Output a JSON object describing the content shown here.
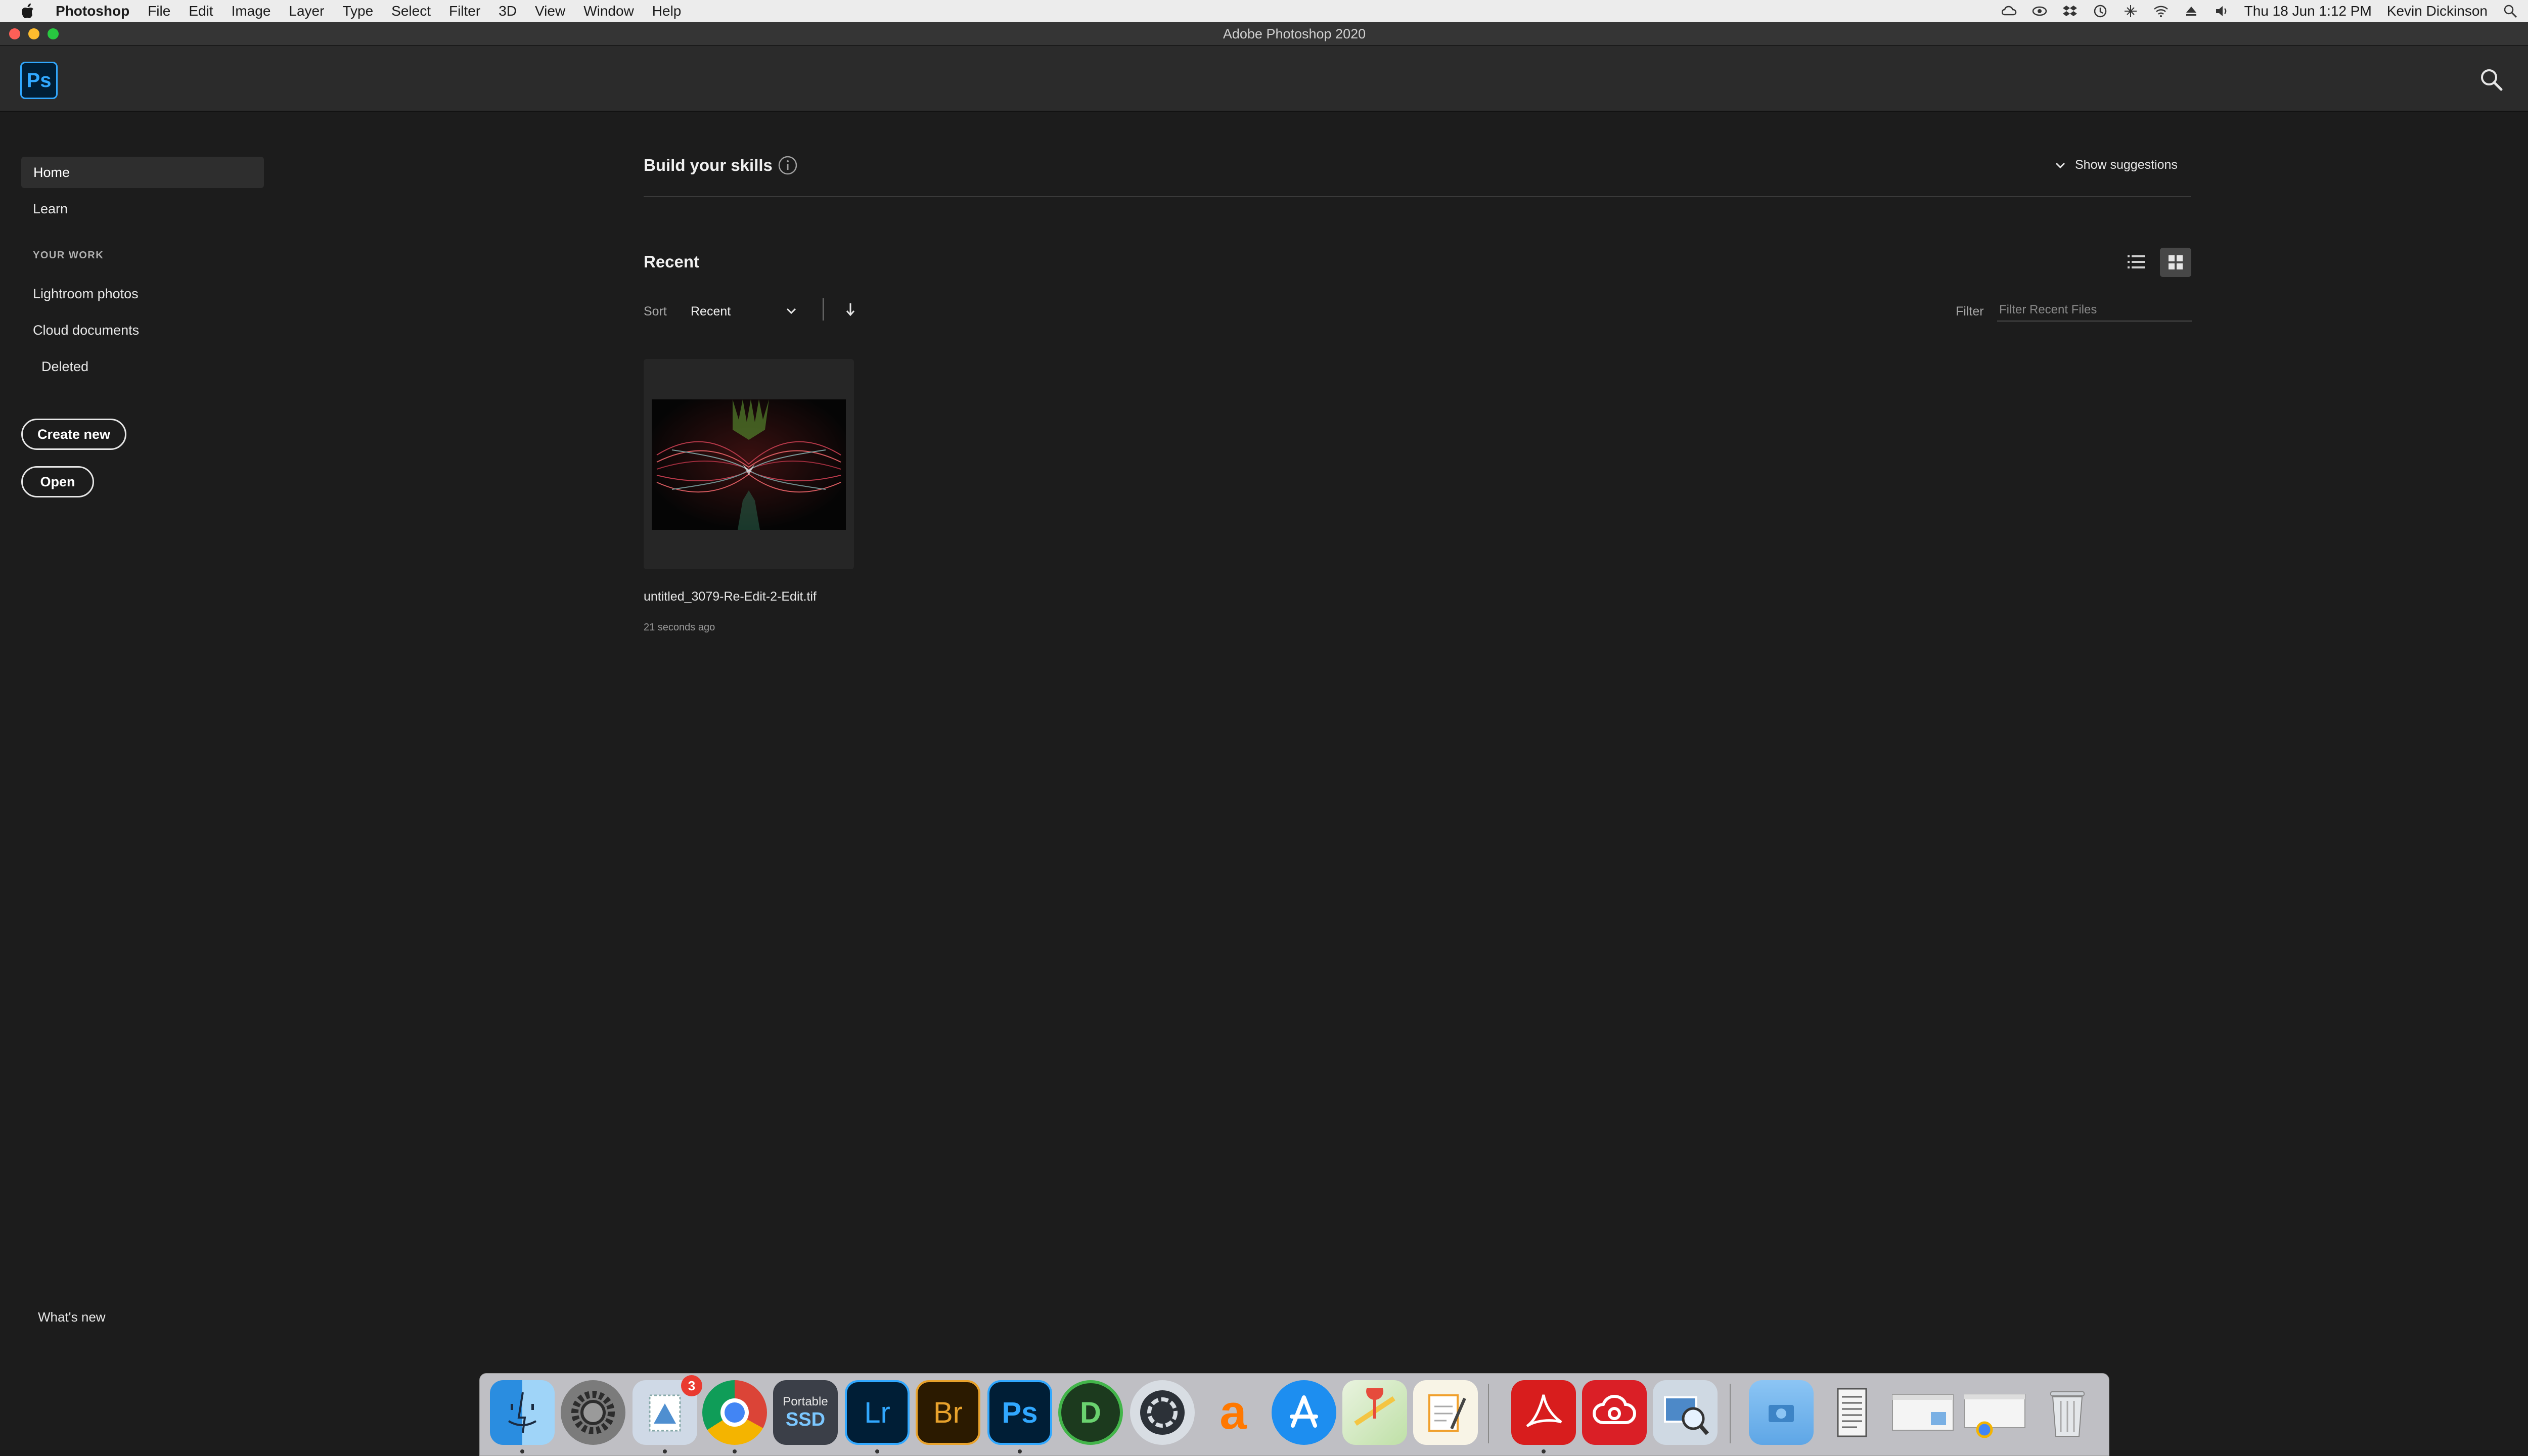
{
  "menubar": {
    "app_name": "Photoshop",
    "menus": [
      "File",
      "Edit",
      "Image",
      "Layer",
      "Type",
      "Select",
      "Filter",
      "3D",
      "View",
      "Window",
      "Help"
    ],
    "clock": "Thu 18 Jun  1:12 PM",
    "user": "Kevin Dickinson"
  },
  "window": {
    "title": "Adobe Photoshop 2020"
  },
  "header": {
    "logo_text": "Ps"
  },
  "sidebar": {
    "home": "Home",
    "learn": "Learn",
    "section_label": "YOUR WORK",
    "lightroom": "Lightroom photos",
    "cloud_docs": "Cloud documents",
    "deleted": "Deleted",
    "create_new": "Create new",
    "open": "Open",
    "whats_new": "What's new"
  },
  "skills": {
    "title": "Build your skills",
    "show_suggestions": "Show suggestions"
  },
  "recent": {
    "title": "Recent",
    "sort_label": "Sort",
    "sort_value": "Recent",
    "filter_label": "Filter",
    "filter_placeholder": "Filter Recent Files",
    "files": [
      {
        "name": "untitled_3079-Re-Edit-2-Edit.tif",
        "time": "21 seconds ago"
      }
    ]
  },
  "dock": {
    "mail_badge": "3",
    "ssd_label_top": "Portable",
    "ssd_label_bottom": "SSD",
    "lr_label": "Lr",
    "br_label": "Br",
    "ps_label": "Ps",
    "d_label": "D",
    "avast_label": "a"
  },
  "colors": {
    "accent_ps": "#31a8ff",
    "background": "#1c1c1c",
    "header": "#2b2b2b",
    "close": "#fe5f57",
    "minimize": "#febc2e",
    "zoom": "#28c840"
  }
}
